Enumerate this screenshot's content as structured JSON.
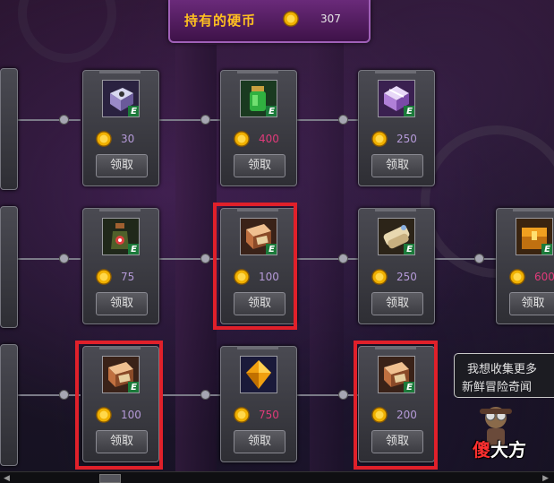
{
  "header": {
    "title": "持有的硬币",
    "coin_count": "307",
    "coin_icon": "gold-coin-icon"
  },
  "rows": [
    {
      "items": [
        {
          "price": "30",
          "claim": "领取",
          "icon": "silver-box-icon",
          "highlighted": false
        },
        {
          "price": "400",
          "claim": "领取",
          "icon": "green-potion-icon",
          "highlighted": false
        },
        {
          "price": "250",
          "claim": "领取",
          "icon": "purple-box-icon",
          "highlighted": false
        }
      ]
    },
    {
      "items": [
        {
          "price": "75",
          "claim": "领取",
          "icon": "bottle-icon",
          "highlighted": false
        },
        {
          "price": "100",
          "claim": "领取",
          "icon": "card-box-icon",
          "highlighted": true
        },
        {
          "price": "250",
          "claim": "领取",
          "icon": "scroll-icon",
          "highlighted": false
        },
        {
          "price": "600",
          "claim": "领取",
          "icon": "gold-box-icon",
          "highlighted": false
        }
      ]
    },
    {
      "items": [
        {
          "price": "100",
          "claim": "领取",
          "icon": "card-box-icon",
          "highlighted": true
        },
        {
          "price": "750",
          "claim": "领取",
          "icon": "gold-crystal-icon",
          "highlighted": false
        },
        {
          "price": "200",
          "claim": "领取",
          "icon": "card-box-icon",
          "highlighted": true
        }
      ]
    }
  ],
  "npc_bubble": {
    "line1": "我想收集更多",
    "line2": "新鲜冒险奇闻"
  },
  "watermark": {
    "char1": "傻",
    "rest": "大方"
  },
  "colors": {
    "highlight": "#e0202a",
    "coin_text": "#ffc020",
    "price_purple": "#b59ad8",
    "price_red": "#e03a7a"
  }
}
